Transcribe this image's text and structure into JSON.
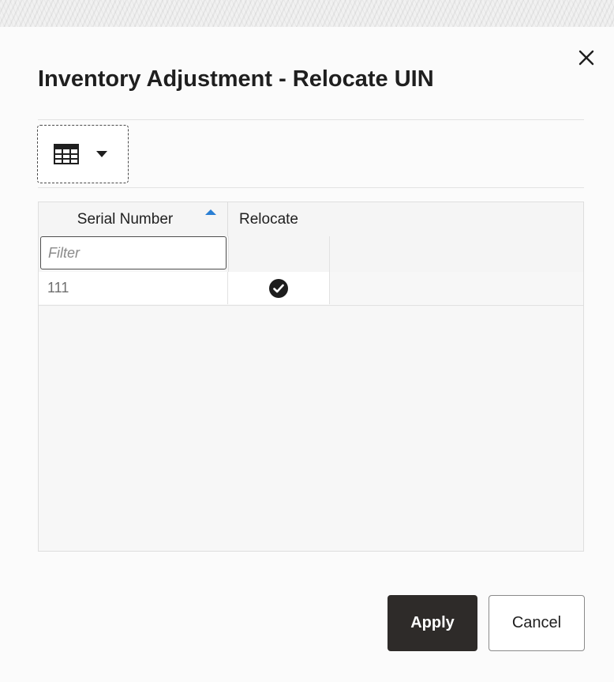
{
  "dialog": {
    "title": "Inventory Adjustment - Relocate UIN",
    "close_icon": "close-icon"
  },
  "toolbar": {
    "view_icon": "table-grid-icon",
    "dropdown_icon": "caret-down-icon"
  },
  "table": {
    "columns": [
      {
        "label": "Serial Number",
        "sort": "ascending"
      },
      {
        "label": "Relocate"
      }
    ],
    "filter_placeholder": "Filter",
    "rows": [
      {
        "serial_number": "111",
        "relocate": true
      }
    ]
  },
  "buttons": {
    "apply_label": "Apply",
    "cancel_label": "Cancel"
  },
  "colors": {
    "accent_sort": "#2a7fd4",
    "primary_button": "#2e2b29"
  }
}
